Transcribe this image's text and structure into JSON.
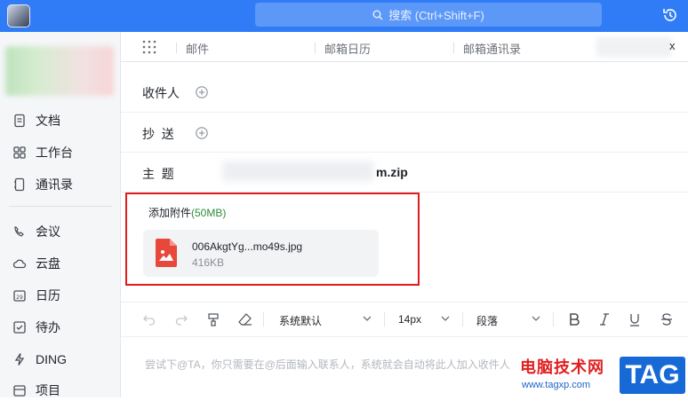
{
  "search": {
    "placeholder": "搜索 (Ctrl+Shift+F)"
  },
  "sidebar": {
    "items": [
      {
        "label": "文档",
        "icon": "document-icon"
      },
      {
        "label": "工作台",
        "icon": "workbench-icon"
      },
      {
        "label": "通讯录",
        "icon": "contacts-icon"
      },
      {
        "label": "会议",
        "icon": "meeting-icon"
      },
      {
        "label": "云盘",
        "icon": "cloud-icon"
      },
      {
        "label": "日历",
        "icon": "calendar-icon"
      },
      {
        "label": "待办",
        "icon": "todo-icon"
      },
      {
        "label": "DING",
        "icon": "ding-icon"
      },
      {
        "label": "项目",
        "icon": "project-icon"
      }
    ]
  },
  "tabs": [
    {
      "label": "邮件"
    },
    {
      "label": "邮箱日历"
    },
    {
      "label": "邮箱通讯录"
    }
  ],
  "tab_close": "x",
  "compose": {
    "to_label": "收件人",
    "cc_label": "抄  送",
    "subject_label": "主  题",
    "subject_visible": "m.zip",
    "attach_label": "添加附件",
    "attach_limit": "(50MB)",
    "file": {
      "name": "006AkgtYg...mo49s.jpg",
      "size": "416KB"
    }
  },
  "toolbar": {
    "font": "系统默认",
    "size": "14px",
    "paragraph": "段落"
  },
  "editor": {
    "placeholder": "尝试下@TA，你只需要在@后面输入联系人，系统就会自动将此人加入收件人"
  },
  "watermark": {
    "cn": "电脑技术网",
    "url": "www.tagxp.com",
    "tag": "TAG"
  },
  "colors": {
    "topbar": "#2f7cf6",
    "highlight_border": "#e01b1b",
    "attach_size": "#2e8b3a"
  }
}
